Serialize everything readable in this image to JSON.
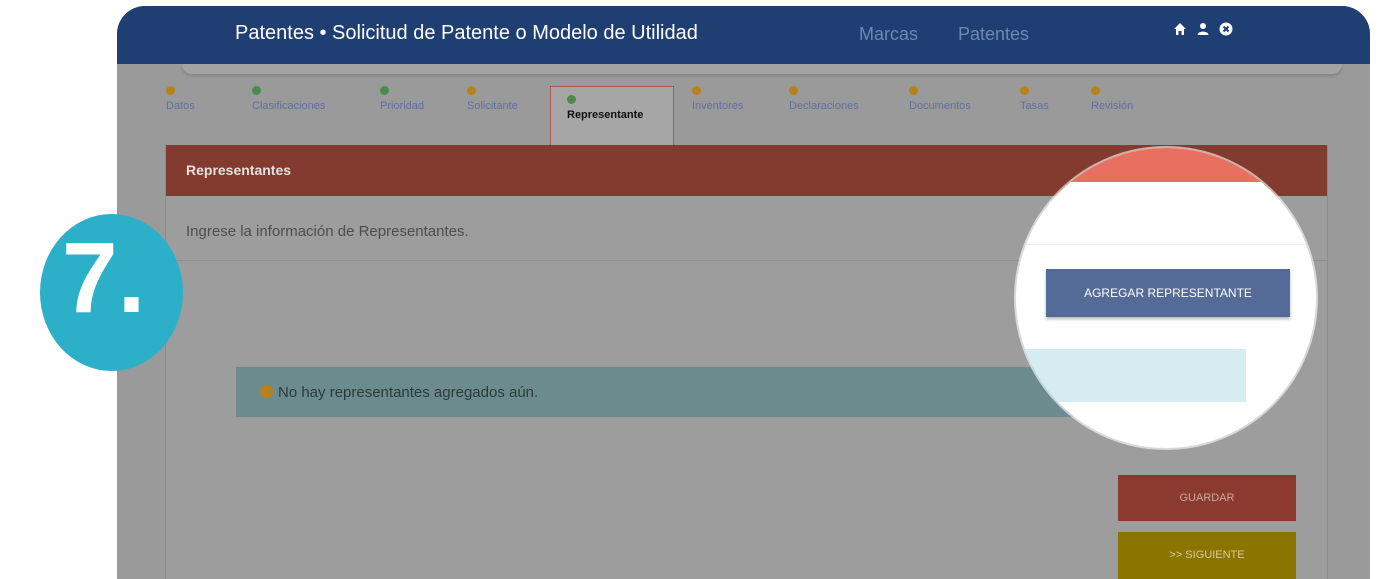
{
  "header": {
    "app_title": "Patentes • Solicitud de Patente o Modelo de Utilidad",
    "nav": [
      "Marcas",
      "Patentes"
    ],
    "icons": [
      "home-icon",
      "user-icon",
      "close-circle-icon"
    ]
  },
  "steps": [
    {
      "label": "Datos",
      "status": "warning"
    },
    {
      "label": "Clasificaciones",
      "status": "ok"
    },
    {
      "label": "Prioridad",
      "status": "ok"
    },
    {
      "label": "Solicitante",
      "status": "warning"
    },
    {
      "label": "Representante",
      "status": "ok",
      "active": true
    },
    {
      "label": "Inventores",
      "status": "warning"
    },
    {
      "label": "Declaraciones",
      "status": "warning"
    },
    {
      "label": "Documentos",
      "status": "warning"
    },
    {
      "label": "Tasas",
      "status": "warning"
    },
    {
      "label": "Revisión",
      "status": "warning"
    }
  ],
  "panel": {
    "title": "Representantes",
    "intro": "Ingrese la información de Representantes.",
    "add_button": "AGREGAR REPRESENTANTE",
    "empty_message": "No hay representantes agregados aún.",
    "save_button": "GUARDAR",
    "next_button": ">> SIGUIENTE"
  },
  "step_badge": "7.",
  "colors": {
    "header": "#1f3f73",
    "panel_header": "#e77060",
    "primary_button": "#546b98",
    "badge": "#2cafc8",
    "save": "#d9534f",
    "next": "#e6c200"
  }
}
